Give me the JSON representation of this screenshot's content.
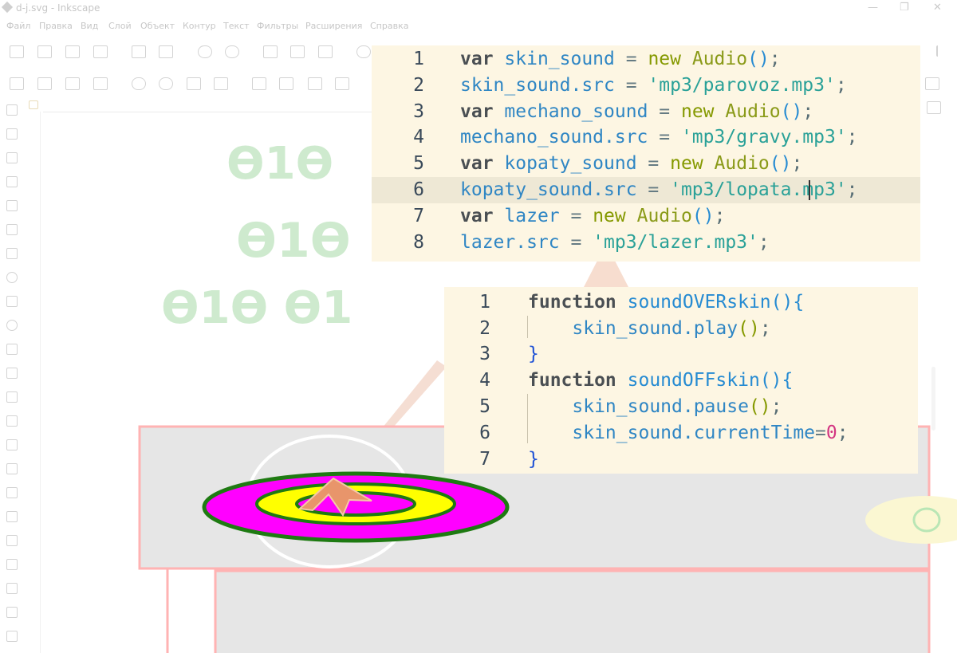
{
  "window": {
    "title": "d-j.svg - Inkscape",
    "controls": [
      "—",
      "❐",
      "✕"
    ]
  },
  "menu": [
    "Файл",
    "Правка",
    "Вид",
    "Слой",
    "Объект",
    "Контур",
    "Текст",
    "Фильтры",
    "Расширения",
    "Справка"
  ],
  "canvas": {
    "glyph_rows": [
      "ϴ1ϴ",
      "ϴ1ϴ",
      "ϴ1ϴ ϴ1"
    ],
    "colors": {
      "magenta": "#ff00ff",
      "yellow": "#ffff00",
      "ring_stroke": "#1e7a12",
      "bg_gray": "#e6e6e6",
      "border_red": "#ffb3b3"
    }
  },
  "code_top": {
    "lines": [
      {
        "num": "1",
        "tokens": [
          [
            "kw",
            "var"
          ],
          [
            "op",
            " "
          ],
          [
            "id",
            "skin_sound"
          ],
          [
            "op",
            " = "
          ],
          [
            "nw",
            "new"
          ],
          [
            "op",
            " "
          ],
          [
            "cls",
            "Audio"
          ],
          [
            "par",
            "()"
          ],
          [
            "pn",
            ";"
          ]
        ]
      },
      {
        "num": "2",
        "tokens": [
          [
            "id",
            "skin_sound.src"
          ],
          [
            "op",
            " = "
          ],
          [
            "str",
            "'mp3/parovoz.mp3'"
          ],
          [
            "pn",
            ";"
          ]
        ]
      },
      {
        "num": "3",
        "tokens": [
          [
            "kw",
            "var"
          ],
          [
            "op",
            " "
          ],
          [
            "id",
            "mechano_sound"
          ],
          [
            "op",
            " = "
          ],
          [
            "nw",
            "new"
          ],
          [
            "op",
            " "
          ],
          [
            "cls",
            "Audio"
          ],
          [
            "par",
            "()"
          ],
          [
            "pn",
            ";"
          ]
        ]
      },
      {
        "num": "4",
        "tokens": [
          [
            "id",
            "mechano_sound.src"
          ],
          [
            "op",
            " = "
          ],
          [
            "str",
            "'mp3/gravy.mp3'"
          ],
          [
            "pn",
            ";"
          ]
        ]
      },
      {
        "num": "5",
        "tokens": [
          [
            "kw",
            "var"
          ],
          [
            "op",
            " "
          ],
          [
            "id",
            "kopaty_sound"
          ],
          [
            "op",
            " = "
          ],
          [
            "nw",
            "new"
          ],
          [
            "op",
            " "
          ],
          [
            "cls",
            "Audio"
          ],
          [
            "par",
            "()"
          ],
          [
            "pn",
            ";"
          ]
        ]
      },
      {
        "num": "6",
        "tokens": [
          [
            "id",
            "kopaty_sound.src"
          ],
          [
            "op",
            " = "
          ],
          [
            "str",
            "'mp3/lopata.mp3'"
          ],
          [
            "pn",
            ";"
          ]
        ],
        "highlight": true
      },
      {
        "num": "7",
        "tokens": [
          [
            "kw",
            "var"
          ],
          [
            "op",
            " "
          ],
          [
            "id",
            "lazer"
          ],
          [
            "op",
            " = "
          ],
          [
            "nw",
            "new"
          ],
          [
            "op",
            " "
          ],
          [
            "cls",
            "Audio"
          ],
          [
            "par",
            "()"
          ],
          [
            "pn",
            ";"
          ]
        ]
      },
      {
        "num": "8",
        "tokens": [
          [
            "id",
            "lazer.src"
          ],
          [
            "op",
            " = "
          ],
          [
            "str",
            "'mp3/lazer.mp3'"
          ],
          [
            "pn",
            ";"
          ]
        ]
      }
    ]
  },
  "code_bottom": {
    "lines": [
      {
        "num": "1",
        "tokens": [
          [
            "kw",
            "function"
          ],
          [
            "op",
            " "
          ],
          [
            "fn",
            "soundOVERskin"
          ],
          [
            "br",
            "(){"
          ]
        ]
      },
      {
        "num": "2",
        "tokens": [
          [
            "op",
            "    "
          ],
          [
            "id",
            "skin_sound.play"
          ],
          [
            "nw",
            "()"
          ],
          [
            "pn",
            ";"
          ]
        ]
      },
      {
        "num": "3",
        "tokens": [
          [
            "brc",
            "}"
          ]
        ]
      },
      {
        "num": "4",
        "tokens": [
          [
            "kw",
            "function"
          ],
          [
            "op",
            " "
          ],
          [
            "fn",
            "soundOFFskin"
          ],
          [
            "br",
            "(){"
          ]
        ]
      },
      {
        "num": "5",
        "tokens": [
          [
            "op",
            "    "
          ],
          [
            "id",
            "skin_sound.pause"
          ],
          [
            "nw",
            "()"
          ],
          [
            "pn",
            ";"
          ]
        ]
      },
      {
        "num": "6",
        "tokens": [
          [
            "op",
            "    "
          ],
          [
            "id",
            "skin_sound.currentTime"
          ],
          [
            "op",
            "="
          ],
          [
            "num",
            "0"
          ],
          [
            "pn",
            ";"
          ]
        ]
      },
      {
        "num": "7",
        "tokens": [
          [
            "brc",
            "}"
          ]
        ]
      }
    ]
  }
}
